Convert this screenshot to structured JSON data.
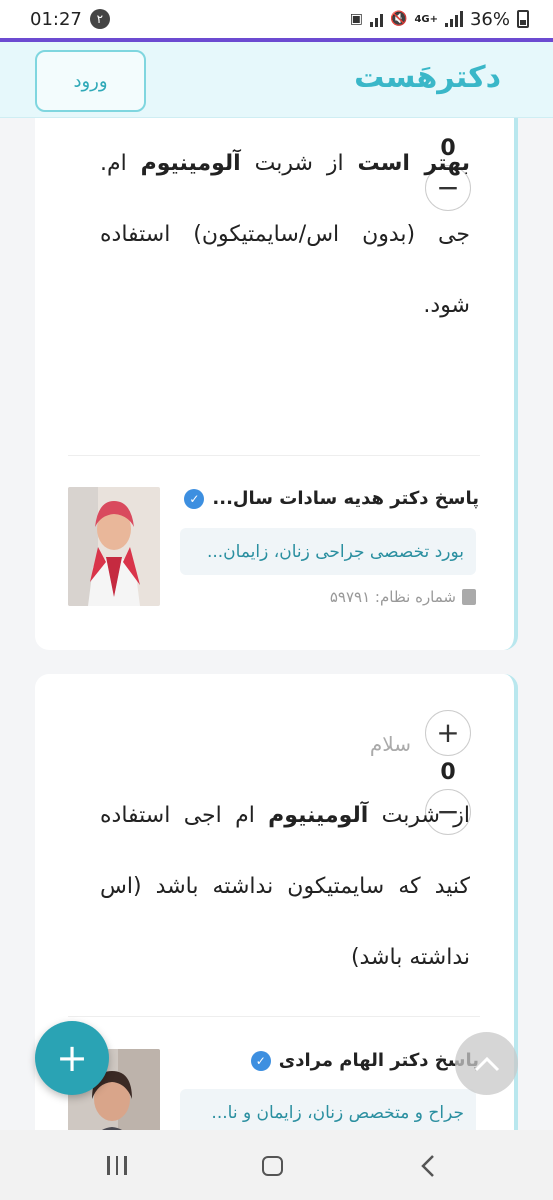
{
  "status_bar": {
    "time": "01:27",
    "notification_count": "۲",
    "network_label": "4G+",
    "battery": "36%"
  },
  "header": {
    "logo": "دکترهَست",
    "login_label": "ورود"
  },
  "questions": [
    {
      "vote_count": "0",
      "answer_parts": [
        {
          "text": "بهتر است",
          "bold": true
        },
        {
          "text": " از شربت ",
          "bold": false
        },
        {
          "text": "آلومینیوم",
          "bold": true
        },
        {
          "text": " ام. جی (بدون اس/سایمتیکون) استفاده شود.",
          "bold": false
        }
      ],
      "doctor": {
        "name": "پاسخ دکتر هدیه سادات سال...",
        "specialty": "بورد تخصصی جراحی زنان، زایمان...",
        "registration": "شماره نظام: ۵۹۷۹۱"
      }
    },
    {
      "greeting": "سلام",
      "vote_count": "0",
      "answer_parts": [
        {
          "text": "از شربت ",
          "bold": false
        },
        {
          "text": "آلومینیوم",
          "bold": true
        },
        {
          "text": " ام اجی استفاده کنید که سایمتیکون نداشته باشد (اس نداشته باشد)",
          "bold": false
        }
      ],
      "doctor": {
        "name": "پاسخ دکتر الهام مرادی",
        "specialty": "جراح و متخصص زنان، زایمان و نا..."
      }
    }
  ],
  "colors": {
    "brand": "#3ab7c8",
    "fab": "#2aa3b4",
    "status_line": "#6c4bd1",
    "verified": "#3d8fe0"
  },
  "icons": {
    "fab": "plus-icon",
    "scroll_top": "chevron-up-icon",
    "verified": "verified-check-icon"
  }
}
